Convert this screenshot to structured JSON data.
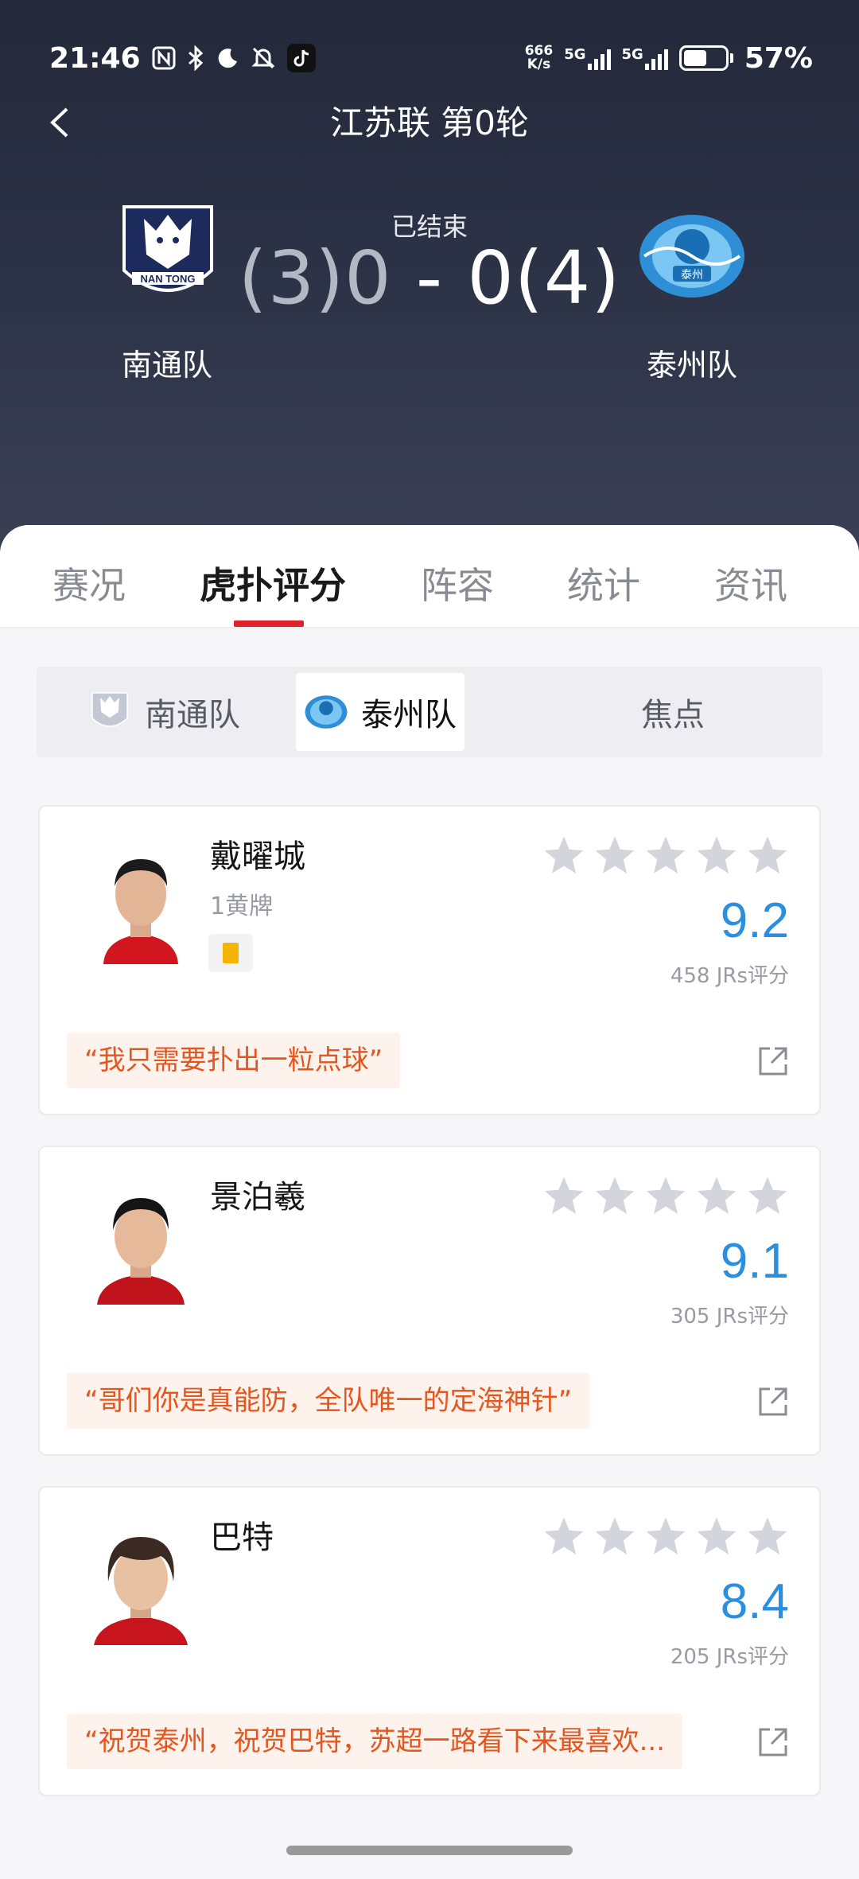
{
  "status_bar": {
    "time": "21:46",
    "net_speed_top": "666",
    "net_speed_bottom": "K/s",
    "sim1": "5G",
    "sim2": "5G",
    "battery_percent": "57%",
    "battery_level": 0.57
  },
  "nav": {
    "title": "江苏联 第0轮"
  },
  "match": {
    "status": "已结束",
    "home_team": "南通队",
    "away_team": "泰州队",
    "home_score": "(3)0",
    "separator": " - ",
    "away_score": "0(4)",
    "home_logo_text": "NAN TONG",
    "away_logo_text": "泰州"
  },
  "tabs": [
    {
      "label": "赛况",
      "active": false
    },
    {
      "label": "虎扑评分",
      "active": true
    },
    {
      "label": "阵容",
      "active": false
    },
    {
      "label": "统计",
      "active": false
    },
    {
      "label": "资讯",
      "active": false
    }
  ],
  "segments": [
    {
      "label": "南通队",
      "active": false
    },
    {
      "label": "泰州队",
      "active": true
    },
    {
      "label": "焦点",
      "active": false
    }
  ],
  "players": [
    {
      "name": "戴曜城",
      "sub": "1黄牌",
      "yellow_cards": 1,
      "rating": "9.2",
      "count": "458 JRs评分",
      "quote": "“我只需要扑出一粒点球”"
    },
    {
      "name": "景泊羲",
      "sub": "",
      "yellow_cards": 0,
      "rating": "9.1",
      "count": "305 JRs评分",
      "quote": "“哥们你是真能防，全队唯一的定海神针”"
    },
    {
      "name": "巴特",
      "sub": "",
      "yellow_cards": 0,
      "rating": "8.4",
      "count": "205 JRs评分",
      "quote": "“祝贺泰州，祝贺巴特，苏超一路看下来最喜欢..."
    }
  ],
  "colors": {
    "accent": "#e0222b",
    "rating": "#2b8fe0",
    "quote": "#e4561e",
    "header_bg": "#2d3347"
  }
}
